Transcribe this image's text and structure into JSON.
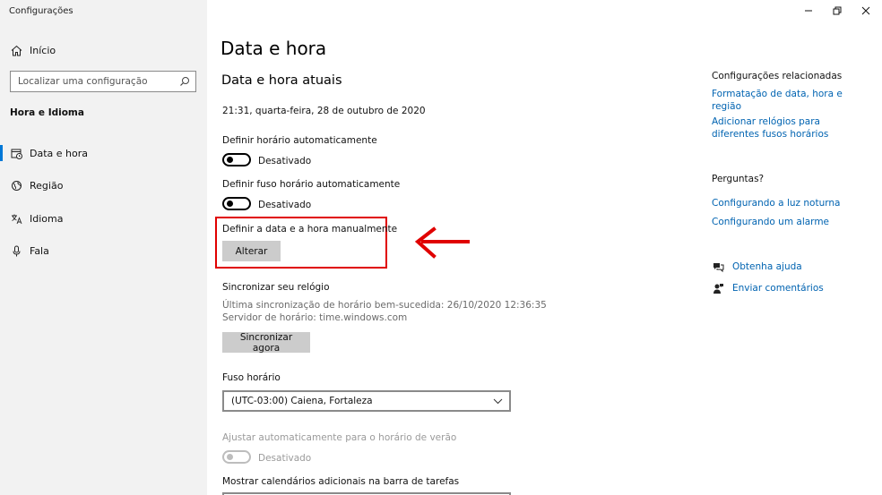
{
  "window": {
    "title": "Configurações",
    "minimize_icon": "minimize-icon",
    "maximize_icon": "restore-icon",
    "close_icon": "close-icon"
  },
  "sidebar": {
    "home_label": "Início",
    "search_placeholder": "Localizar uma configuração",
    "group_title": "Hora e Idioma",
    "items": [
      {
        "label": "Data e hora",
        "icon": "calendar-clock-icon",
        "active": true
      },
      {
        "label": "Região",
        "icon": "globe-icon",
        "active": false
      },
      {
        "label": "Idioma",
        "icon": "language-icon",
        "active": false
      },
      {
        "label": "Fala",
        "icon": "microphone-icon",
        "active": false
      }
    ]
  },
  "main": {
    "page_title": "Data e hora",
    "section_title": "Data e hora atuais",
    "current_datetime": "21:31, quarta-feira, 28 de outubro de 2020",
    "auto_time": {
      "label": "Definir horário automaticamente",
      "state": "Desativado"
    },
    "auto_timezone": {
      "label": "Definir fuso horário automaticamente",
      "state": "Desativado"
    },
    "manual": {
      "label": "Definir a data e a hora manualmente",
      "button": "Alterar"
    },
    "sync": {
      "title": "Sincronizar seu relógio",
      "last_sync": "Última sincronização de horário bem-sucedida: 26/10/2020 12:36:35",
      "server": "Servidor de horário: time.windows.com",
      "button": "Sincronizar agora"
    },
    "timezone": {
      "label": "Fuso horário",
      "value": "(UTC-03:00) Caiena, Fortaleza"
    },
    "dst": {
      "label": "Ajustar automaticamente para o horário de verão",
      "state": "Desativado"
    },
    "extra_calendars": {
      "label": "Mostrar calendários adicionais na barra de tarefas"
    }
  },
  "related": {
    "title": "Configurações relacionadas",
    "links": [
      "Formatação de data, hora e região",
      "Adicionar relógios para diferentes fusos horários"
    ]
  },
  "questions": {
    "title": "Perguntas?",
    "links": [
      "Configurando a luz noturna",
      "Configurando um alarme"
    ]
  },
  "help": {
    "get_help": "Obtenha ajuda",
    "feedback": "Enviar comentários"
  },
  "colors": {
    "accent": "#0078d7",
    "link": "#0063b1",
    "annotation": "#e00000"
  }
}
